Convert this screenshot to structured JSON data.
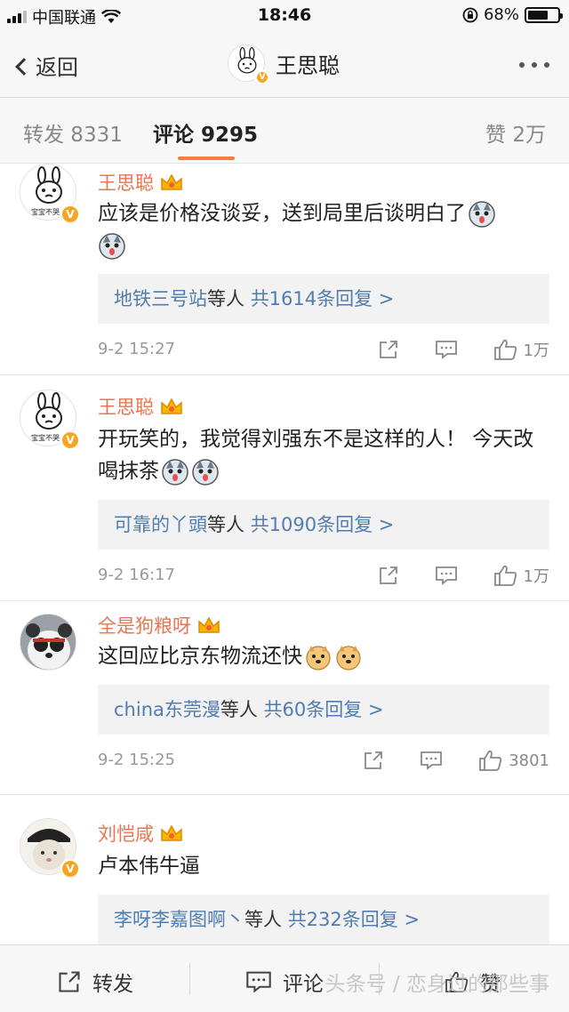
{
  "status_bar": {
    "carrier": "中国联通",
    "time": "18:46",
    "battery": "68%",
    "battery_level": 0.68
  },
  "nav": {
    "back_label": "返回",
    "title": "王思聪",
    "more_icon": "more-dots-icon"
  },
  "tabs": {
    "repost": "转发 8331",
    "comment": "评论 9295",
    "like": "赞 2万",
    "accent_color": "#fa7d3c"
  },
  "comments": [
    {
      "username": "王思聪",
      "text": "应该是价格没谈妥，送到局里后谈明白了",
      "emoji_count": 2,
      "reply_users": "地铁三号站",
      "reply_mid": "等人 ",
      "reply_total": "共1614条回复 >",
      "time": "9-2 15:27",
      "likes": "1万",
      "avatar_caption": "宝宝不哭"
    },
    {
      "username": "王思聪",
      "text": "开玩笑的，我觉得刘强东不是这样的人！ 今天改喝抹茶",
      "emoji_count": 2,
      "reply_users": "可靠的丫頭",
      "reply_mid": "等人 ",
      "reply_total": "共1090条回复 >",
      "time": "9-2 16:17",
      "likes": "1万",
      "avatar_caption": "宝宝不哭"
    },
    {
      "username": "全是狗粮呀",
      "text": "这回应比京东物流还快",
      "emoji_count": 2,
      "reply_users": "china东莞漫",
      "reply_mid": "等人 ",
      "reply_total": "共60条回复 >",
      "time": "9-2 15:25",
      "likes": "3801"
    },
    {
      "username": "刘恺咸",
      "text": "卢本伟牛逼",
      "emoji_count": 0,
      "reply_users": "李呀李嘉图啊丶",
      "reply_mid": "等人 ",
      "reply_total": "共232条回复 >"
    }
  ],
  "bottom_bar": {
    "repost": "转发",
    "comment": "评论",
    "like": "赞",
    "watermark": "头条号 / 恋身过的那些事"
  },
  "colors": {
    "username": "#eb7350",
    "link": "#507daf",
    "verified_badge": "#f5a623"
  }
}
